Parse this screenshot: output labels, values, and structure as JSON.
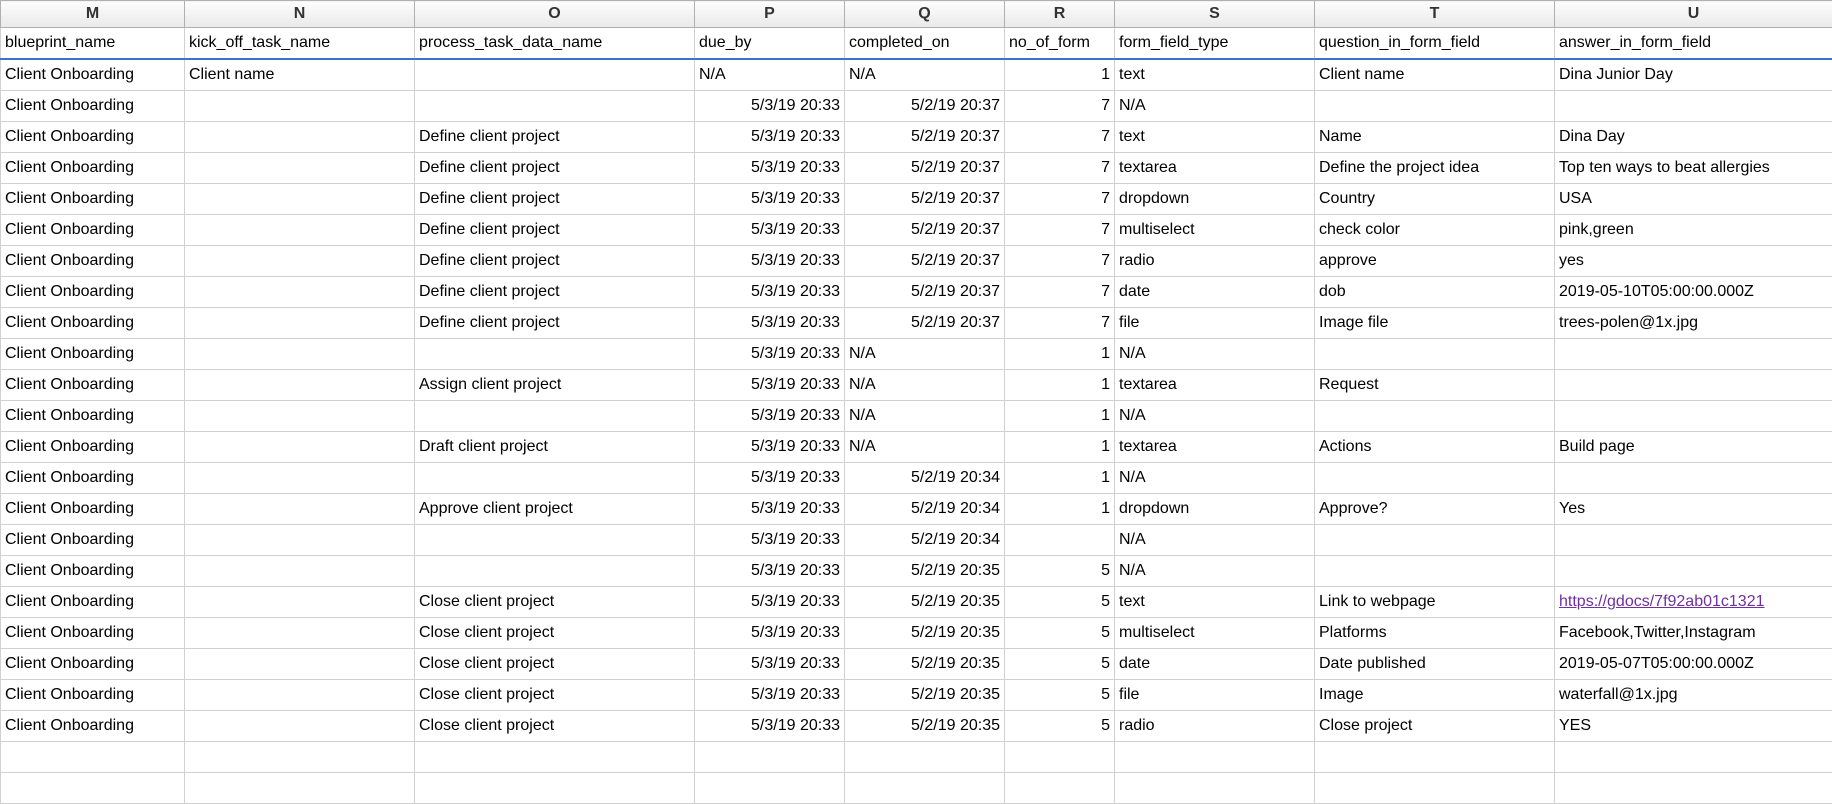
{
  "columns": [
    {
      "letter": "M",
      "header": "blueprint_name",
      "class": "col-M"
    },
    {
      "letter": "N",
      "header": "kick_off_task_name",
      "class": "col-N"
    },
    {
      "letter": "O",
      "header": "process_task_data_name",
      "class": "col-O"
    },
    {
      "letter": "P",
      "header": "due_by",
      "class": "col-P"
    },
    {
      "letter": "Q",
      "header": "completed_on",
      "class": "col-Q"
    },
    {
      "letter": "R",
      "header": "no_of_form",
      "class": "col-R"
    },
    {
      "letter": "S",
      "header": "form_field_type",
      "class": "col-S"
    },
    {
      "letter": "T",
      "header": "question_in_form_field",
      "class": "col-T"
    },
    {
      "letter": "U",
      "header": "answer_in_form_field",
      "class": "col-U"
    }
  ],
  "rows": [
    {
      "M": "Client Onboarding",
      "N": "Client name",
      "O": "",
      "P": "N/A",
      "Q": "N/A",
      "R": "1",
      "S": "text",
      "T": "Client name",
      "U": "Dina Junior Day"
    },
    {
      "M": "Client Onboarding",
      "N": "",
      "O": "",
      "P": "5/3/19 20:33",
      "Q": "5/2/19 20:37",
      "R": "7",
      "S": "N/A",
      "T": "",
      "U": ""
    },
    {
      "M": "Client Onboarding",
      "N": "",
      "O": "Define client project",
      "P": "5/3/19 20:33",
      "Q": "5/2/19 20:37",
      "R": "7",
      "S": "text",
      "T": "Name",
      "U": "Dina Day"
    },
    {
      "M": "Client Onboarding",
      "N": "",
      "O": "Define client project",
      "P": "5/3/19 20:33",
      "Q": "5/2/19 20:37",
      "R": "7",
      "S": "textarea",
      "T": "Define the project idea",
      "U": "Top ten ways to beat allergies"
    },
    {
      "M": "Client Onboarding",
      "N": "",
      "O": "Define client project",
      "P": "5/3/19 20:33",
      "Q": "5/2/19 20:37",
      "R": "7",
      "S": "dropdown",
      "T": "Country",
      "U": "USA"
    },
    {
      "M": "Client Onboarding",
      "N": "",
      "O": "Define client project",
      "P": "5/3/19 20:33",
      "Q": "5/2/19 20:37",
      "R": "7",
      "S": "multiselect",
      "T": "check color",
      "U": "pink,green"
    },
    {
      "M": "Client Onboarding",
      "N": "",
      "O": "Define client project",
      "P": "5/3/19 20:33",
      "Q": "5/2/19 20:37",
      "R": "7",
      "S": "radio",
      "T": "approve",
      "U": "yes"
    },
    {
      "M": "Client Onboarding",
      "N": "",
      "O": "Define client project",
      "P": "5/3/19 20:33",
      "Q": "5/2/19 20:37",
      "R": "7",
      "S": "date",
      "T": "dob",
      "U": "2019-05-10T05:00:00.000Z"
    },
    {
      "M": "Client Onboarding",
      "N": "",
      "O": "Define client project",
      "P": "5/3/19 20:33",
      "Q": "5/2/19 20:37",
      "R": "7",
      "S": "file",
      "T": "Image file",
      "U": "trees-polen@1x.jpg"
    },
    {
      "M": "Client Onboarding",
      "N": "",
      "O": "",
      "P": "5/3/19 20:33",
      "Q": "N/A",
      "R": "1",
      "S": "N/A",
      "T": "",
      "U": ""
    },
    {
      "M": "Client Onboarding",
      "N": "",
      "O": "Assign client project",
      "P": "5/3/19 20:33",
      "Q": "N/A",
      "R": "1",
      "S": "textarea",
      "T": "Request",
      "U": ""
    },
    {
      "M": "Client Onboarding",
      "N": "",
      "O": "",
      "P": "5/3/19 20:33",
      "Q": "N/A",
      "R": "1",
      "S": "N/A",
      "T": "",
      "U": ""
    },
    {
      "M": "Client Onboarding",
      "N": "",
      "O": "Draft client project",
      "P": "5/3/19 20:33",
      "Q": "N/A",
      "R": "1",
      "S": "textarea",
      "T": "Actions",
      "U": "Build page"
    },
    {
      "M": "Client Onboarding",
      "N": "",
      "O": "",
      "P": "5/3/19 20:33",
      "Q": "5/2/19 20:34",
      "R": "1",
      "S": "N/A",
      "T": "",
      "U": ""
    },
    {
      "M": "Client Onboarding",
      "N": "",
      "O": "Approve client project",
      "P": "5/3/19 20:33",
      "Q": "5/2/19 20:34",
      "R": "1",
      "S": "dropdown",
      "T": "Approve?",
      "U": "Yes"
    },
    {
      "M": "Client Onboarding",
      "N": "",
      "O": "",
      "P": "5/3/19 20:33",
      "Q": "5/2/19 20:34",
      "R": "",
      "S": "N/A",
      "T": "",
      "U": ""
    },
    {
      "M": "Client Onboarding",
      "N": "",
      "O": "",
      "P": "5/3/19 20:33",
      "Q": "5/2/19 20:35",
      "R": "5",
      "S": "N/A",
      "T": "",
      "U": ""
    },
    {
      "M": "Client Onboarding",
      "N": "",
      "O": "Close client project",
      "P": "5/3/19 20:33",
      "Q": "5/2/19 20:35",
      "R": "5",
      "S": "text",
      "T": "Link to webpage",
      "U": "https://gdocs/7f92ab01c1321",
      "link": true
    },
    {
      "M": "Client Onboarding",
      "N": "",
      "O": "Close client project",
      "P": "5/3/19 20:33",
      "Q": "5/2/19 20:35",
      "R": "5",
      "S": "multiselect",
      "T": "Platforms",
      "U": "Facebook,Twitter,Instagram"
    },
    {
      "M": "Client Onboarding",
      "N": "",
      "O": "Close client project",
      "P": "5/3/19 20:33",
      "Q": "5/2/19 20:35",
      "R": "5",
      "S": "date",
      "T": "Date published",
      "U": "2019-05-07T05:00:00.000Z"
    },
    {
      "M": "Client Onboarding",
      "N": "",
      "O": "Close client project",
      "P": "5/3/19 20:33",
      "Q": "5/2/19 20:35",
      "R": "5",
      "S": "file",
      "T": "Image",
      "U": "waterfall@1x.jpg"
    },
    {
      "M": "Client Onboarding",
      "N": "",
      "O": "Close client project",
      "P": "5/3/19 20:33",
      "Q": "5/2/19 20:35",
      "R": "5",
      "S": "radio",
      "T": "Close project",
      "U": "YES"
    },
    {
      "M": "",
      "N": "",
      "O": "",
      "P": "",
      "Q": "",
      "R": "",
      "S": "",
      "T": "",
      "U": ""
    },
    {
      "M": "",
      "N": "",
      "O": "",
      "P": "",
      "Q": "",
      "R": "",
      "S": "",
      "T": "",
      "U": ""
    }
  ],
  "numeric_columns": [
    "R"
  ],
  "right_align_columns": [
    "P",
    "Q",
    "R"
  ]
}
